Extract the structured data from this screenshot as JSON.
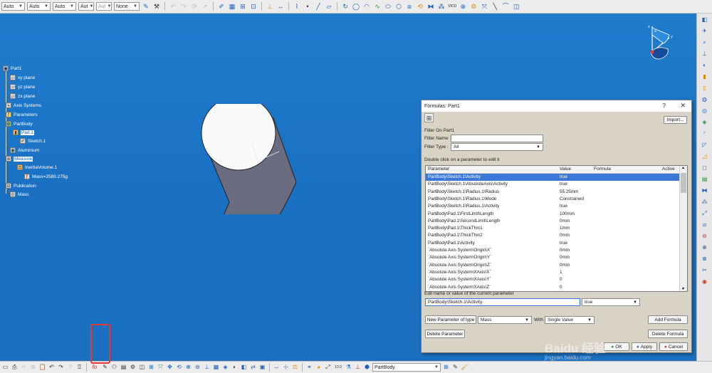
{
  "toolbar": {
    "combos": [
      "Auto",
      "Auto",
      "Auto",
      "Aut",
      "Aut",
      "None"
    ],
    "top_right_label": "VIC0"
  },
  "tree": {
    "part": "Part1",
    "xy": "xy plane",
    "yz": "yz plane",
    "zx": "zx plane",
    "axis": "Axis Systems",
    "params": "Parameters",
    "body": "PartBody",
    "pad": "Pad.1",
    "sketch": "Sketch.1",
    "material": "Aluminium",
    "measure": "Measure",
    "inertia": "InertiaVolume.1",
    "mass_value": "Mass=2589.275g",
    "publication": "Publication",
    "mass": "Mass"
  },
  "dialog": {
    "title": "Formulas: Part1",
    "help": "?",
    "close": "✕",
    "import": "Import...",
    "filter_on": "Filter On Part1",
    "filter_name_label": "Filter Name :",
    "filter_type_label": "Filter Type :",
    "filter_type_value": "All",
    "hint": "Double click on a parameter to edit it",
    "columns": [
      "Parameter",
      "Value",
      "Formula",
      "Active"
    ],
    "rows": [
      [
        "PartBody\\Sketch.1\\Activity",
        "true"
      ],
      [
        "PartBody\\Sketch.1\\AbsoluteAxis\\Activity",
        "true"
      ],
      [
        "PartBody\\Sketch.1\\Radius.1\\Radius",
        "55.25mm"
      ],
      [
        "PartBody\\Sketch.1\\Radius.1\\Mode",
        "Constrained"
      ],
      [
        "PartBody\\Sketch.1\\Radius.1\\Activity",
        "true"
      ],
      [
        "PartBody\\Pad.1\\FirstLimit\\Length",
        "100mm"
      ],
      [
        "PartBody\\Pad.1\\SecondLimit\\Length",
        "0mm"
      ],
      [
        "PartBody\\Pad.1\\ThickThin1",
        "1mm"
      ],
      [
        "PartBody\\Pad.1\\ThickThin2",
        "0mm"
      ],
      [
        "PartBody\\Pad.1\\Activity",
        "true"
      ],
      [
        "`Absolute Axis System\\Origin\\X`",
        "0mm"
      ],
      [
        "`Absolute Axis System\\Origin\\Y`",
        "0mm"
      ],
      [
        "`Absolute Axis System\\Origin\\Z`",
        "0mm"
      ],
      [
        "`Absolute Axis System\\XAxis\\X`",
        "1"
      ],
      [
        "`Absolute Axis System\\XAxis\\Y`",
        "0"
      ],
      [
        "`Absolute Axis System\\XAxis\\Z`",
        "0"
      ]
    ],
    "edit_label": "Edit name or value of the current parameter",
    "edit_name": "PartBody\\Sketch.1\\Activity",
    "edit_value": "true",
    "new_param_button": "New Parameter of type",
    "param_type": "Mass",
    "with_label": "With",
    "with_value": "Single Value",
    "add_formula": "Add Formula",
    "delete_param": "Delete Parameter",
    "delete_formula": "Delete Formula",
    "ok": "OK",
    "apply": "Apply",
    "cancel": "Cancel"
  },
  "bottombar": {
    "icon_label": "fo",
    "body_select": "PartBody"
  },
  "watermark": {
    "main": "Baidu 经验",
    "sub": "jingyan.baidu.com"
  }
}
